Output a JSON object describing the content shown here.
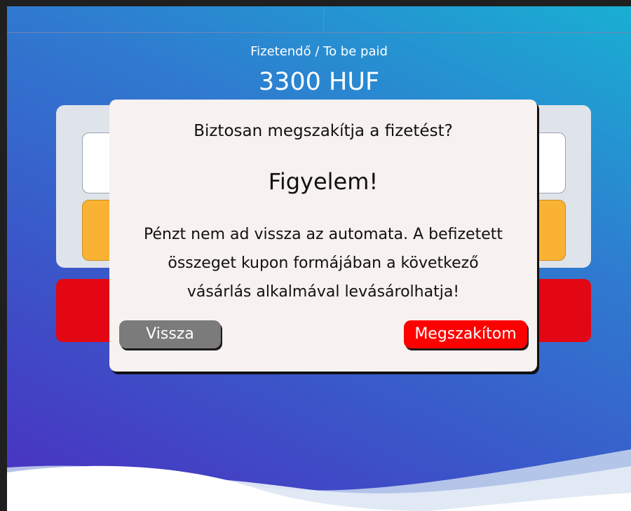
{
  "payment": {
    "label": "Fizetendő / To be paid",
    "amount": "3300 HUF"
  },
  "dialog": {
    "question": "Biztosan megszakítja a fizetést?",
    "warning_title": "Figyelem!",
    "message_lines": [
      "Pénzt nem ad vissza az automata. A befizetett",
      "összeget kupon formájában a következő",
      "vásárlás alkalmával levásárolhatja!"
    ],
    "back_button": "Vissza",
    "abort_button": "Megszakítom"
  },
  "colors": {
    "background_start": "#4a2fc0",
    "background_end": "#19afd2",
    "dialog_bg": "#f7f1f0",
    "back_button": "#7b7b7b",
    "abort_button": "#ff0000",
    "yellow_option": "#f9b233",
    "red_option": "#e30613"
  }
}
